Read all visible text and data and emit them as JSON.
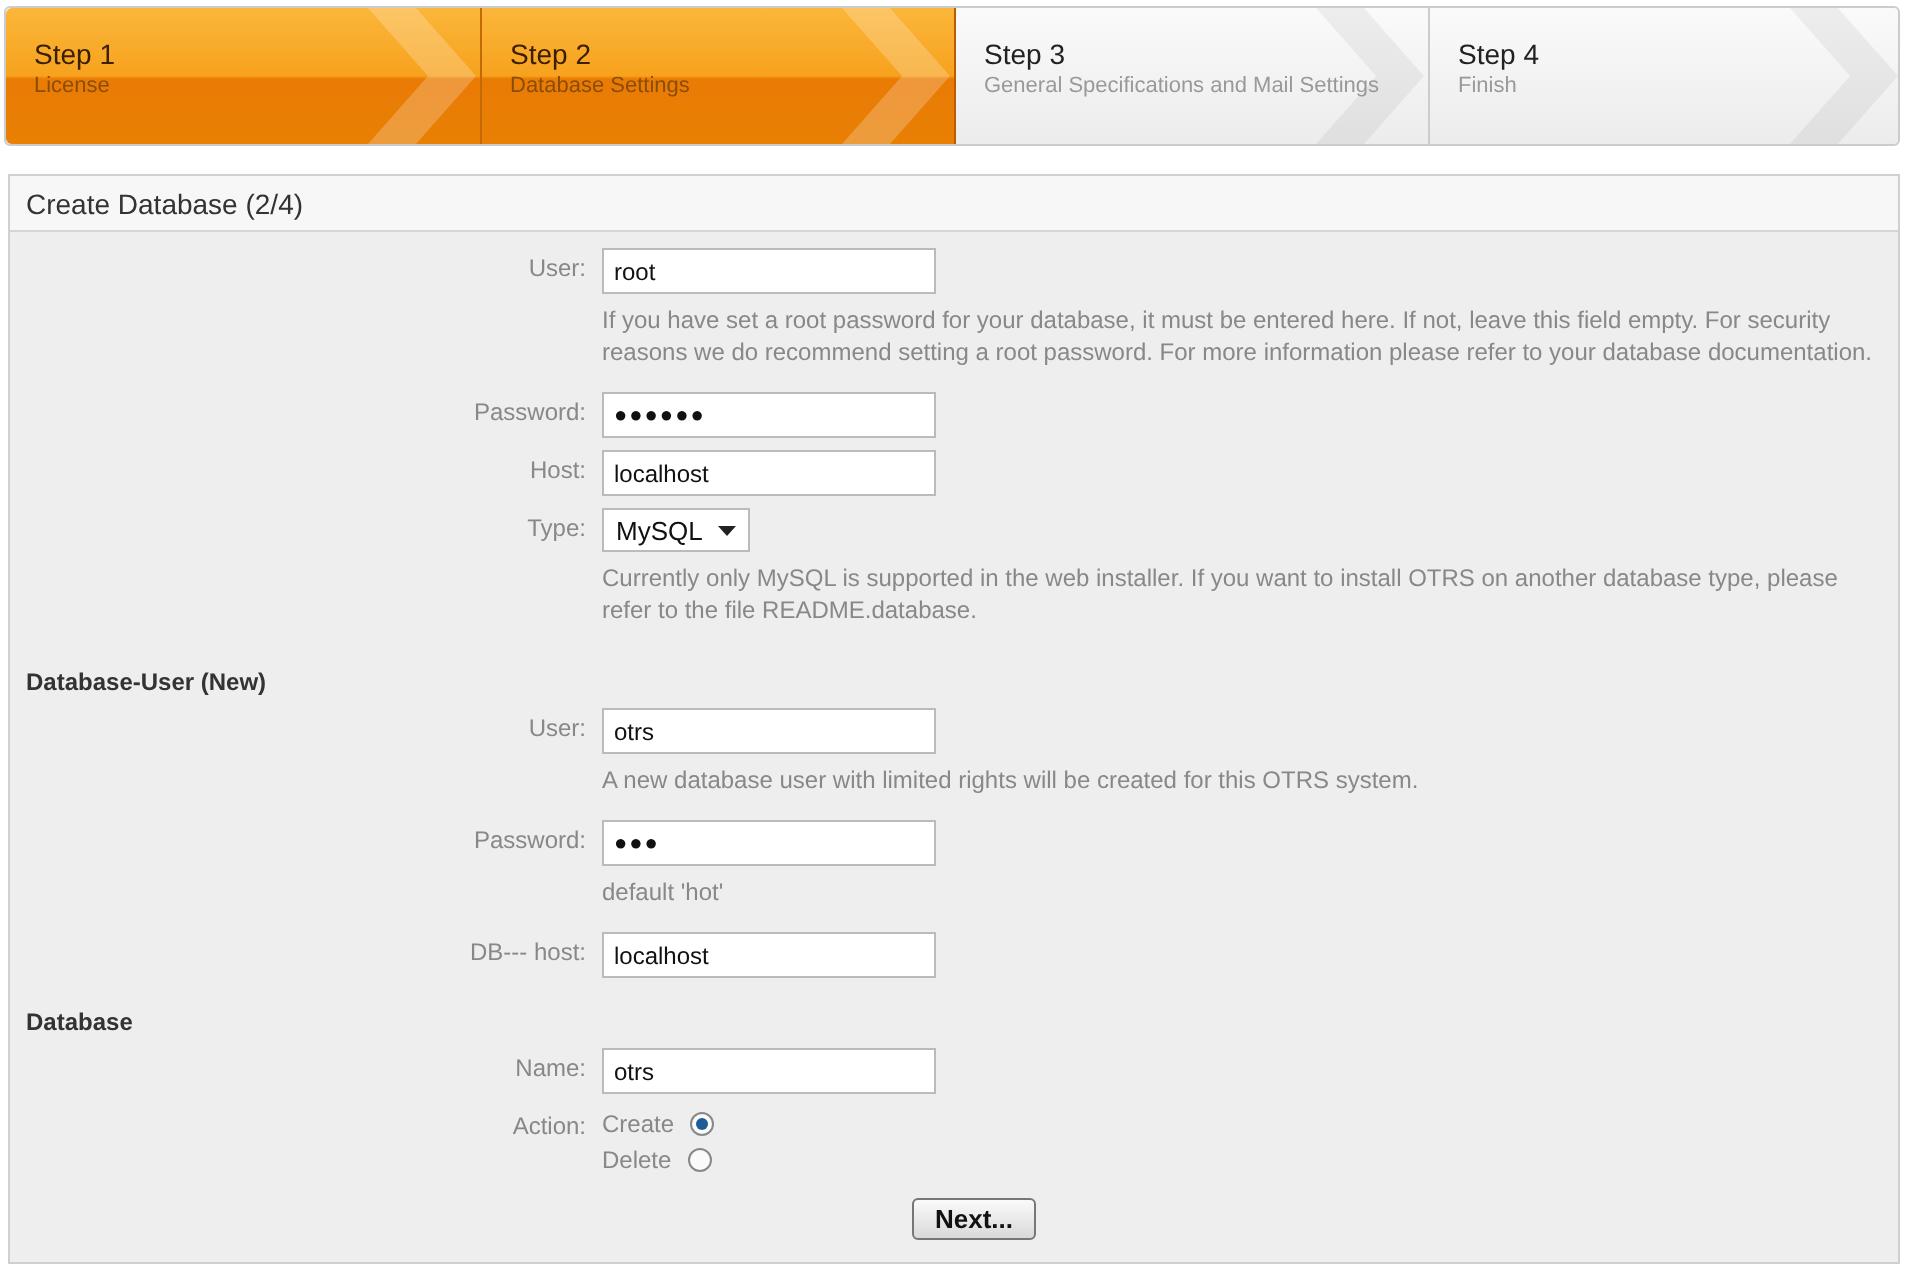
{
  "steps": [
    {
      "title": "Step 1",
      "subtitle": "License",
      "completed": true
    },
    {
      "title": "Step 2",
      "subtitle": "Database Settings",
      "completed": true
    },
    {
      "title": "Step 3",
      "subtitle": "General Specifications and Mail Settings",
      "completed": false
    },
    {
      "title": "Step 4",
      "subtitle": "Finish",
      "completed": false
    }
  ],
  "panel": {
    "title": "Create Database (2/4)",
    "sections": [
      {
        "fields": [
          {
            "kind": "text",
            "label": "User:",
            "value": "root",
            "hint": "If you have set a root password for your database, it must be entered here. If not, leave this field empty. For security reasons we do recommend setting a root password. For more information please refer to your database documentation."
          },
          {
            "kind": "password",
            "label": "Password:",
            "value": "●●●●●●"
          },
          {
            "kind": "text",
            "label": "Host:",
            "value": "localhost"
          },
          {
            "kind": "select",
            "label": "Type:",
            "value": "MySQL",
            "hint": "Currently only MySQL is supported in the web installer. If you want to install OTRS on another database type, please refer to the file README.database."
          }
        ]
      },
      {
        "heading": "Database-User (New)",
        "fields": [
          {
            "kind": "text",
            "label": "User:",
            "value": "otrs",
            "hint": "A new database user with limited rights will be created for this OTRS system."
          },
          {
            "kind": "password",
            "label": "Password:",
            "value": "●●●",
            "hint": "default 'hot'"
          },
          {
            "kind": "text",
            "label": "DB--- host:",
            "value": "localhost"
          }
        ]
      },
      {
        "heading": "Database",
        "fields": [
          {
            "kind": "text",
            "label": "Name:",
            "value": "otrs"
          },
          {
            "kind": "radio",
            "label": "Action:",
            "options": [
              {
                "label": "Create",
                "selected": true
              },
              {
                "label": "Delete",
                "selected": false
              }
            ]
          }
        ]
      }
    ],
    "button": "Next..."
  }
}
